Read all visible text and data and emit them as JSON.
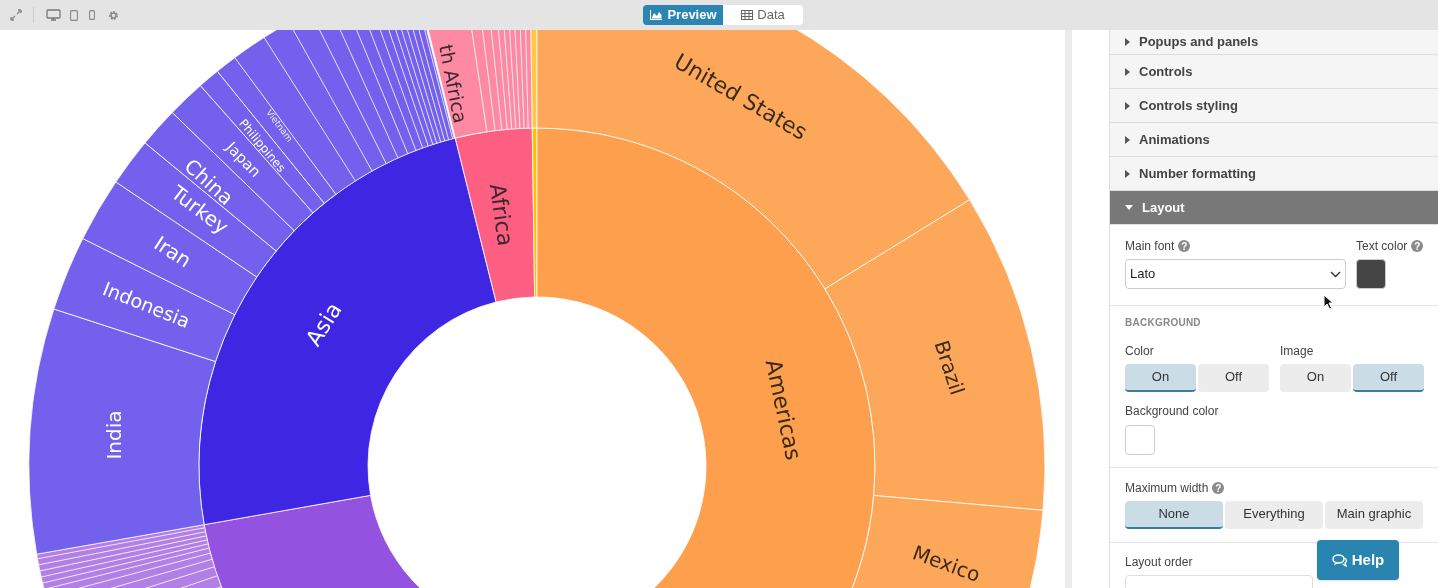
{
  "toolbar": {
    "tabs": [
      {
        "label": "Preview",
        "selected": true
      },
      {
        "label": "Data",
        "selected": false
      }
    ]
  },
  "sunburst": {
    "inner_labels": [
      "Asia",
      "Africa",
      "Americas"
    ],
    "outer_labels": [
      "India",
      "Indonesia",
      "Iran",
      "Turkey",
      "China",
      "Japan",
      "Philippines",
      "Vietnam",
      "th Africa",
      "United States",
      "Brazil",
      "Mexico"
    ]
  },
  "settings_panel": {
    "sections": [
      {
        "title": "Popups and panels",
        "expanded": false
      },
      {
        "title": "Controls",
        "expanded": false
      },
      {
        "title": "Controls styling",
        "expanded": false
      },
      {
        "title": "Animations",
        "expanded": false
      },
      {
        "title": "Number formatting",
        "expanded": false
      },
      {
        "title": "Layout",
        "expanded": true
      }
    ],
    "layout": {
      "main_font": {
        "label": "Main font",
        "hint_icon": "?",
        "value": "Lato"
      },
      "text_color": {
        "label": "Text color",
        "hint_icon": "?"
      },
      "background_heading": "BACKGROUND",
      "color_toggle": {
        "label": "Color",
        "options": [
          {
            "label": "On",
            "selected": true
          },
          {
            "label": "Off",
            "selected": false
          }
        ]
      },
      "image_toggle": {
        "label": "Image",
        "options": [
          {
            "label": "On",
            "selected": false
          },
          {
            "label": "Off",
            "selected": true
          }
        ]
      },
      "background_color_label": "Background color",
      "max_width": {
        "label": "Maximum width",
        "hint_icon": "?",
        "options": [
          {
            "label": "None",
            "selected": true
          },
          {
            "label": "Everything",
            "selected": false
          },
          {
            "label": "Main graphic",
            "selected": false
          }
        ]
      },
      "layout_order_label": "Layout order"
    }
  },
  "help_button": "Help"
}
